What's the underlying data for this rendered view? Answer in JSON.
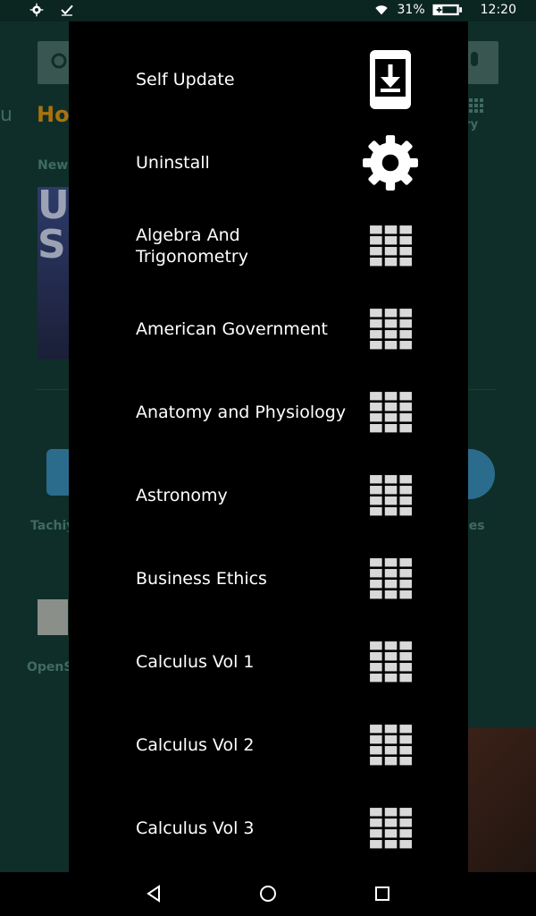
{
  "status_bar": {
    "battery": "31%",
    "time": "12:20",
    "icons": [
      "settings-icon",
      "check-icon",
      "wifi-icon",
      "battery-charging-icon"
    ]
  },
  "background": {
    "tab_left": "u",
    "home": "Ho",
    "library": "rary",
    "new": "New",
    "book_letters": "U.\nS.",
    "app1": "Tachiy",
    "app2": "les",
    "app3": "OpenS"
  },
  "drawer": {
    "items": [
      {
        "label": "Self Update",
        "icon": "download-icon"
      },
      {
        "label": "Uninstall",
        "icon": "gear-icon"
      },
      {
        "label": "Algebra And Trigonometry",
        "icon": "grid-icon"
      },
      {
        "label": "American Government",
        "icon": "grid-icon"
      },
      {
        "label": "Anatomy and Physiology",
        "icon": "grid-icon"
      },
      {
        "label": "Astronomy",
        "icon": "grid-icon"
      },
      {
        "label": "Business Ethics",
        "icon": "grid-icon"
      },
      {
        "label": "Calculus Vol 1",
        "icon": "grid-icon"
      },
      {
        "label": "Calculus Vol 2",
        "icon": "grid-icon"
      },
      {
        "label": "Calculus Vol 3",
        "icon": "grid-icon"
      }
    ]
  },
  "navbar": {
    "buttons": [
      "back-icon",
      "home-icon",
      "recents-icon"
    ]
  }
}
